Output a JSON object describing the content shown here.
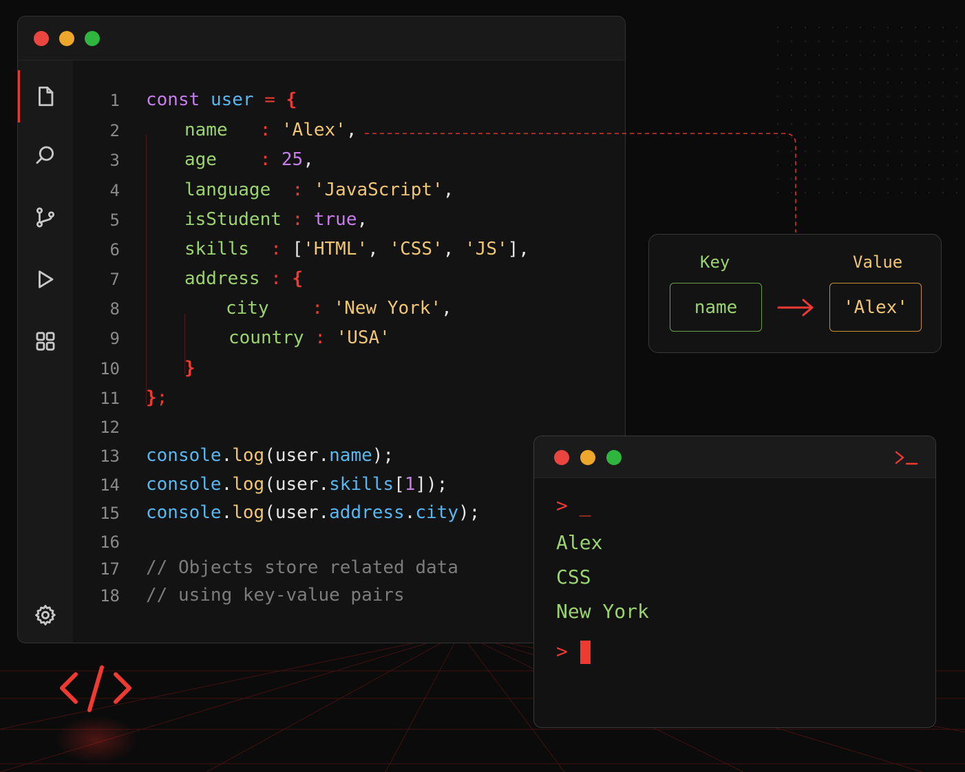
{
  "editor": {
    "line_numbers": [
      "1",
      "2",
      "3",
      "4",
      "5",
      "6",
      "7",
      "8",
      "9",
      "10",
      "11",
      "12",
      "13",
      "14",
      "15",
      "16",
      "17",
      "18"
    ],
    "sidebar_icons": [
      "file-icon",
      "search-icon",
      "git-branch-icon",
      "run-icon",
      "extensions-icon",
      "settings-gear-icon"
    ],
    "code": {
      "l1": {
        "kw": "const",
        "var": "user",
        "op": "=",
        "brace": "{"
      },
      "l2": {
        "key": "name",
        "colon": ":",
        "val": "'Alex'",
        "comma": ","
      },
      "l3": {
        "key": "age",
        "colon": ":",
        "val": "25",
        "comma": ","
      },
      "l4": {
        "key": "language",
        "colon": ":",
        "val": "'JavaScript'",
        "comma": ","
      },
      "l5": {
        "key": "isStudent",
        "colon": ":",
        "val": "true",
        "comma": ","
      },
      "l6": {
        "key": "skills",
        "colon": ":",
        "open": "[",
        "v1": "'HTML'",
        "c1": ",",
        "v2": "'CSS'",
        "c2": ",",
        "v3": "'JS'",
        "close": "],"
      },
      "l7": {
        "key": "address",
        "colon": ":",
        "brace": "{"
      },
      "l8": {
        "key": "city",
        "colon": ":",
        "val": "'New York'",
        "comma": ","
      },
      "l9": {
        "key": "country",
        "colon": ":",
        "val": "'USA'"
      },
      "l10": {
        "brace": "}"
      },
      "l11": {
        "brace": "}",
        "semi": ";"
      },
      "l13": {
        "obj": "console",
        "dot": ".",
        "fn": "log",
        "open": "(",
        "arg": "user",
        "dot2": ".",
        "prop": "name",
        "close": ");"
      },
      "l14": {
        "obj": "console",
        "dot": ".",
        "fn": "log",
        "open": "(",
        "arg": "user",
        "dot2": ".",
        "prop": "skills",
        "idx_open": "[",
        "idx": "1",
        "idx_close": "]",
        "close": ");"
      },
      "l15": {
        "obj": "console",
        "dot": ".",
        "fn": "log",
        "open": "(",
        "arg": "user",
        "dot2": ".",
        "prop": "address",
        "dot3": ".",
        "prop2": "city",
        "close": ");"
      },
      "l17": "// Objects store related data",
      "l18": "// using key-value pairs"
    }
  },
  "kv_panel": {
    "key_header": "Key",
    "value_header": "Value",
    "key_value": "name",
    "value_value": "'Alex'"
  },
  "terminal": {
    "prompt_symbol": ">",
    "first_cursor": "_",
    "outputs": [
      "Alex",
      "CSS",
      "New York"
    ]
  },
  "colors": {
    "accent_red": "#ef3a32",
    "keyword_purple": "#c77dea",
    "variable_blue": "#58b7ef",
    "key_green": "#9bd36e",
    "string_yellow": "#f0c674",
    "comment_gray": "#7c7c7c"
  }
}
